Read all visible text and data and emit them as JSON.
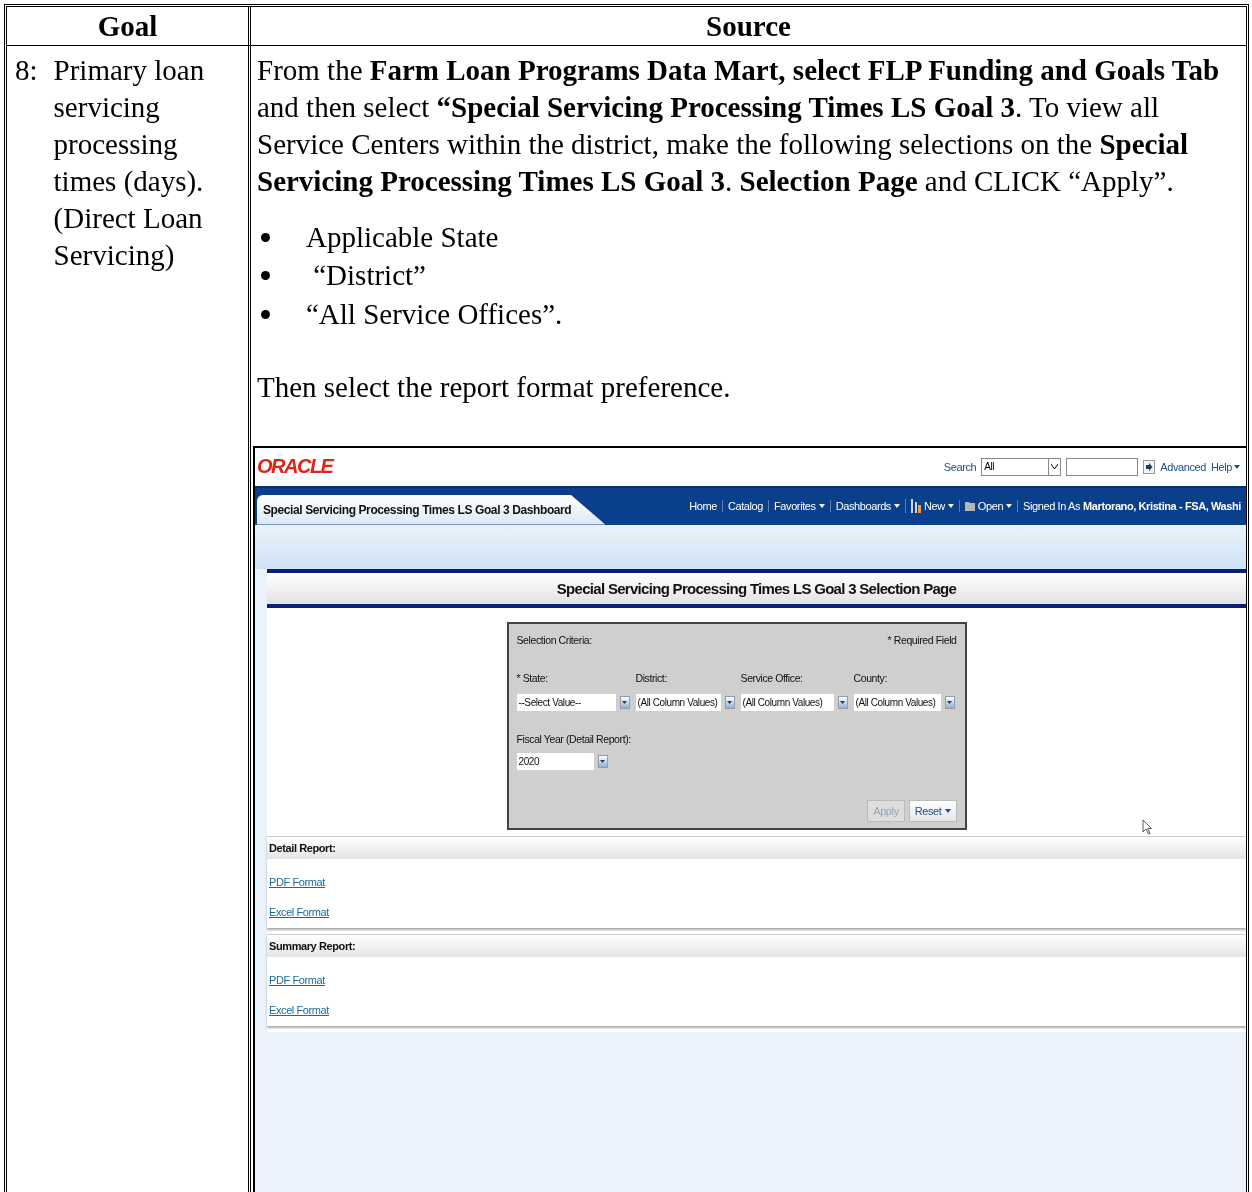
{
  "table": {
    "columns": [
      "Goal",
      "Source"
    ],
    "rows": [
      {
        "goal": {
          "number": "8:",
          "text": "Primary loan servicing processing times (days). (Direct Loan Servicing)"
        },
        "source": {
          "intro": "From the **Farm Loan Programs Data Mart, select FLP Funding and Goals Tab** and then select **“Special Servicing Processing Times LS Goal 3**.  To view all Service Centers within the district, make the following selections on the **Special Servicing Processing Times LS Goal 3**. **Selection Page** and CLICK “Apply”.",
          "bullets": [
            "Applicable State",
            " “District”",
            "“All Service Offices”."
          ],
          "outro": "Then select the report format preference.",
          "screenshot": {
            "logo": "ORACLE",
            "search": {
              "label": "Search",
              "scope": "All",
              "links": [
                "Advanced",
                "Help"
              ]
            },
            "dashboard_tab": "Special Servicing Processing Times LS Goal 3 Dashboard",
            "nav": [
              {
                "label": "Home",
                "kind": "link"
              },
              {
                "label": "Catalog",
                "kind": "link"
              },
              {
                "label": "Favorites",
                "kind": "menu"
              },
              {
                "label": "Dashboards",
                "kind": "menu"
              },
              {
                "label": "New",
                "kind": "new-menu"
              },
              {
                "label": "Open",
                "kind": "open-menu"
              }
            ],
            "signed_in": {
              "label": "Signed In As",
              "user": "Martorano, Kristina - FSA, Washi"
            },
            "page_title": "Special Servicing Processing Times LS Goal 3 Selection Page",
            "prompts": {
              "title": "Selection Criteria:",
              "required_note": "* Required Field",
              "fields": [
                {
                  "label": "* State:",
                  "value": "--Select Value--"
                },
                {
                  "label": "District:",
                  "value": "(All Column Values)"
                },
                {
                  "label": "Service Office:",
                  "value": "(All Column Values)"
                },
                {
                  "label": "County:",
                  "value": "(All Column Values)"
                }
              ],
              "fiscal_year": {
                "label": "Fiscal Year (Detail Report):",
                "value": "2020"
              },
              "buttons": [
                {
                  "label": "Apply",
                  "disabled": true,
                  "kind": "plain"
                },
                {
                  "label": "Reset",
                  "disabled": false,
                  "kind": "menu"
                }
              ]
            },
            "sections": [
              {
                "title": "Detail Report:",
                "links": [
                  "PDF Format",
                  "Excel Format"
                ]
              },
              {
                "title": "Summary Report:",
                "links": [
                  "PDF Format",
                  "Excel Format"
                ]
              }
            ]
          }
        }
      }
    ]
  }
}
